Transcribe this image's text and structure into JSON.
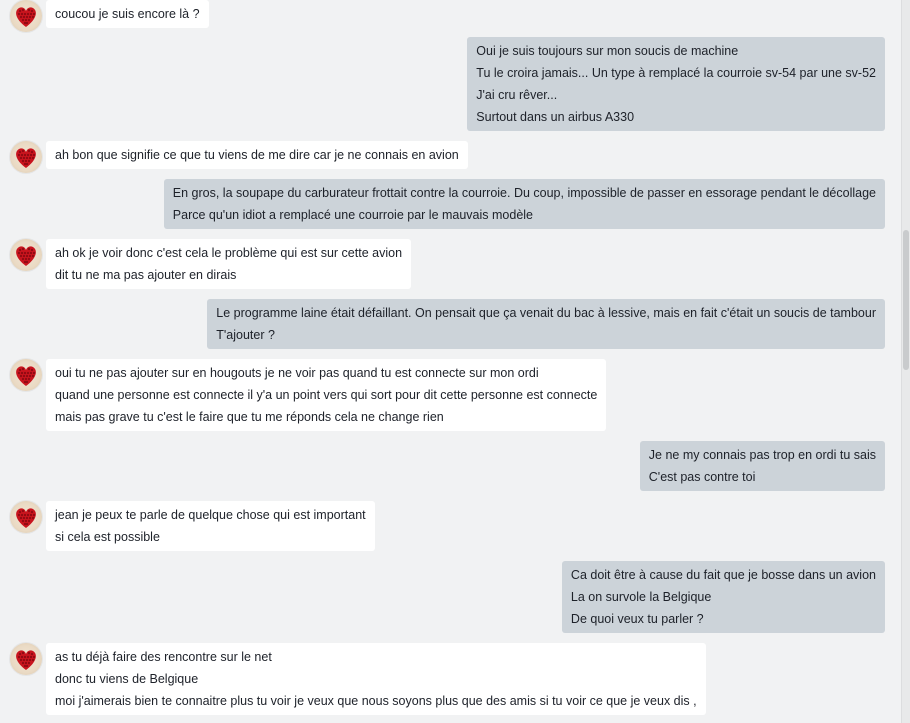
{
  "colors": {
    "background": "#f1f2f3",
    "incoming_bubble": "#ffffff",
    "outgoing_bubble": "#ccd3d9",
    "avatar_heart": "#c8141e"
  },
  "avatar_icon": "red-heart-roses-icon",
  "messages": [
    {
      "side": "in",
      "lines": [
        "coucou je suis encore là ?"
      ]
    },
    {
      "side": "out",
      "lines": [
        "Oui je suis toujours sur mon soucis de machine",
        "Tu le croira jamais... Un type à remplacé la courroie sv-54 par une sv-52",
        "J'ai cru rêver...",
        "Surtout dans un airbus A330"
      ]
    },
    {
      "side": "in",
      "lines": [
        "ah bon que signifie ce que tu viens de me dire car je ne connais en avion"
      ]
    },
    {
      "side": "out",
      "lines": [
        "En gros, la soupape du carburateur frottait contre la courroie. Du coup, impossible de passer en essorage pendant le décollage",
        "Parce qu'un idiot a remplacé une courroie par le mauvais modèle"
      ]
    },
    {
      "side": "in",
      "lines": [
        "ah ok je voir donc c'est cela le problème qui est sur cette avion",
        "dit tu ne ma pas ajouter en dirais"
      ]
    },
    {
      "side": "out",
      "lines": [
        "Le programme laine était défaillant. On pensait que ça venait du bac à lessive, mais en fait c'était un soucis de tambour",
        "T'ajouter ?"
      ]
    },
    {
      "side": "in",
      "lines": [
        " oui tu ne pas ajouter sur en hougouts je ne voir pas quand tu est connecte sur mon ordi",
        "quand une personne est connecte il y'a un point vers qui sort pour dit cette personne est connecte",
        "mais pas grave tu c'est le faire que tu me réponds cela ne change rien"
      ]
    },
    {
      "side": "out",
      "lines": [
        "Je ne my connais pas trop en ordi tu sais",
        "C'est pas contre toi"
      ]
    },
    {
      "side": "in",
      "lines": [
        "jean je peux te parle de quelque chose qui est important",
        "si cela est possible"
      ]
    },
    {
      "side": "out",
      "lines": [
        "Ca doit être à cause du fait que je bosse dans un avion",
        "La on survole la Belgique",
        "De quoi veux tu parler ?"
      ]
    },
    {
      "side": "in",
      "lines": [
        "as tu déjà faire des rencontre sur le net",
        "donc tu viens de Belgique",
        "moi  j'aimerais bien te connaitre plus tu voir je veux que nous soyons plus que des amis si tu voir ce que je veux dis ,"
      ]
    }
  ]
}
